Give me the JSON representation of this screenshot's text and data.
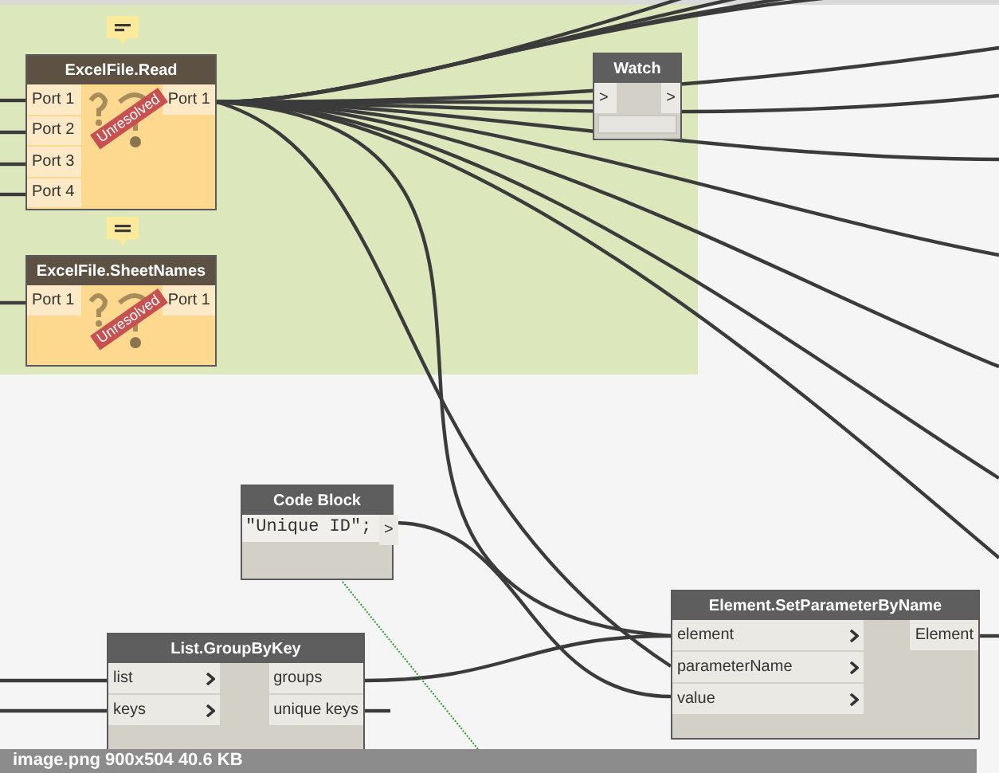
{
  "group": {
    "kind": "group"
  },
  "nodes": [
    {
      "kind": "unresolved",
      "title": "ExcelFile.Read",
      "badge": "Unresolved",
      "has_note": true,
      "inputs": [
        {
          "label": "Port 1"
        },
        {
          "label": "Port 2"
        },
        {
          "label": "Port 3"
        },
        {
          "label": "Port 4"
        }
      ],
      "outputs": [
        {
          "label": "Port 1"
        }
      ]
    },
    {
      "kind": "unresolved",
      "title": "ExcelFile.SheetNames",
      "badge": "Unresolved",
      "has_note": true,
      "inputs": [
        {
          "label": "Port 1"
        }
      ],
      "outputs": [
        {
          "label": "Port 1"
        }
      ]
    },
    {
      "kind": "watch",
      "title": "Watch",
      "inputs": [
        {
          "label": ">"
        }
      ],
      "outputs": [
        {
          "label": ">"
        }
      ]
    },
    {
      "kind": "code",
      "title": "Code Block",
      "code": "\"Unique ID\";",
      "outputs": [
        {
          "label": ">"
        }
      ]
    },
    {
      "kind": "normal",
      "title": "List.GroupByKey",
      "inputs": [
        {
          "label": "list"
        },
        {
          "label": "keys"
        }
      ],
      "outputs": [
        {
          "label": "groups"
        },
        {
          "label": "unique keys"
        }
      ]
    },
    {
      "kind": "normal",
      "title": "Element.SetParameterByName",
      "inputs": [
        {
          "label": "element"
        },
        {
          "label": "parameterName"
        },
        {
          "label": "value"
        }
      ],
      "outputs": [
        {
          "label": "Element"
        }
      ]
    }
  ],
  "caption": "image.png   900x504 40.6 KB"
}
